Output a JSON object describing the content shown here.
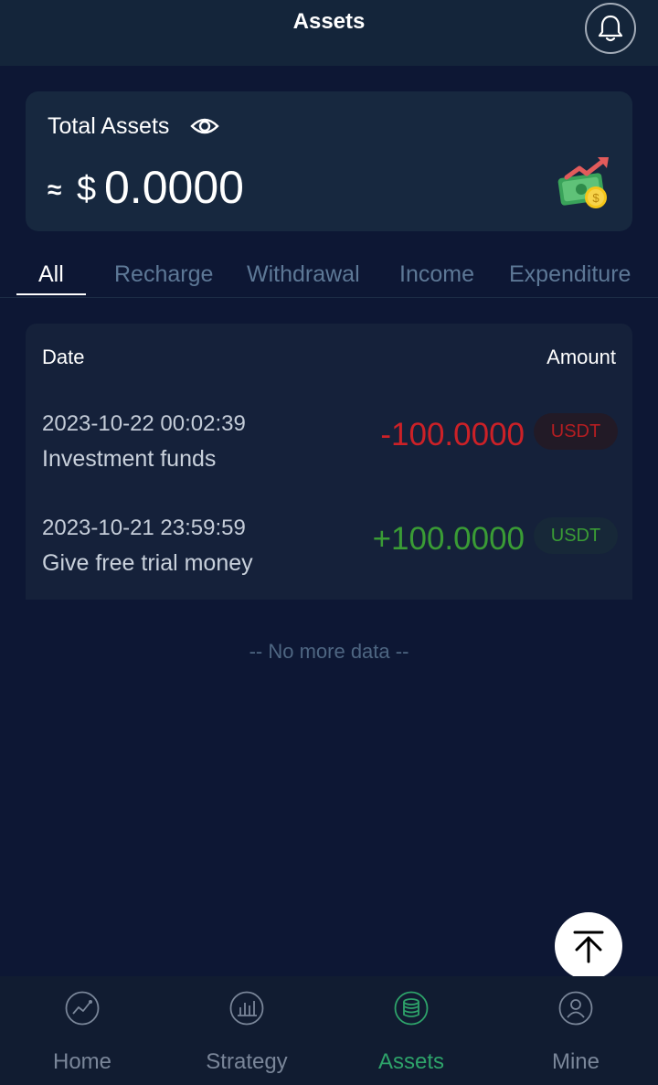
{
  "header": {
    "title": "Assets",
    "bell_icon": "bell-icon"
  },
  "asset_card": {
    "label": "Total Assets",
    "approx_symbol": "≈",
    "currency": "$",
    "value": "0.0000",
    "eye_icon": "eye-icon",
    "illustration_icon": "money-growth-icon"
  },
  "tabs": [
    {
      "label": "All",
      "active": true
    },
    {
      "label": "Recharge",
      "active": false
    },
    {
      "label": "Withdrawal",
      "active": false
    },
    {
      "label": "Income",
      "active": false
    },
    {
      "label": "Expenditure",
      "active": false
    }
  ],
  "records": {
    "columns": {
      "date": "Date",
      "amount": "Amount"
    },
    "items": [
      {
        "datetime": "2023-10-22 00:02:39",
        "description": "Investment funds",
        "amount": "-100.0000",
        "currency": "USDT",
        "direction": "negative"
      },
      {
        "datetime": "2023-10-21 23:59:59",
        "description": "Give free trial money",
        "amount": "+100.0000",
        "currency": "USDT",
        "direction": "positive"
      }
    ],
    "end_text": "-- No more data --"
  },
  "scroll_top_icon": "arrow-up-to-top-icon",
  "bottom_nav": [
    {
      "label": "Home",
      "icon": "chart-line-icon",
      "active": false
    },
    {
      "label": "Strategy",
      "icon": "bar-chart-icon",
      "active": false
    },
    {
      "label": "Assets",
      "icon": "coins-stack-icon",
      "active": true
    },
    {
      "label": "Mine",
      "icon": "user-icon",
      "active": false
    }
  ],
  "colors": {
    "background": "#0d1734",
    "card": "#17283f",
    "negative": "#cc2127",
    "positive": "#3a9c35",
    "active_nav": "#2ea36a",
    "inactive_tab": "#5d7896"
  }
}
